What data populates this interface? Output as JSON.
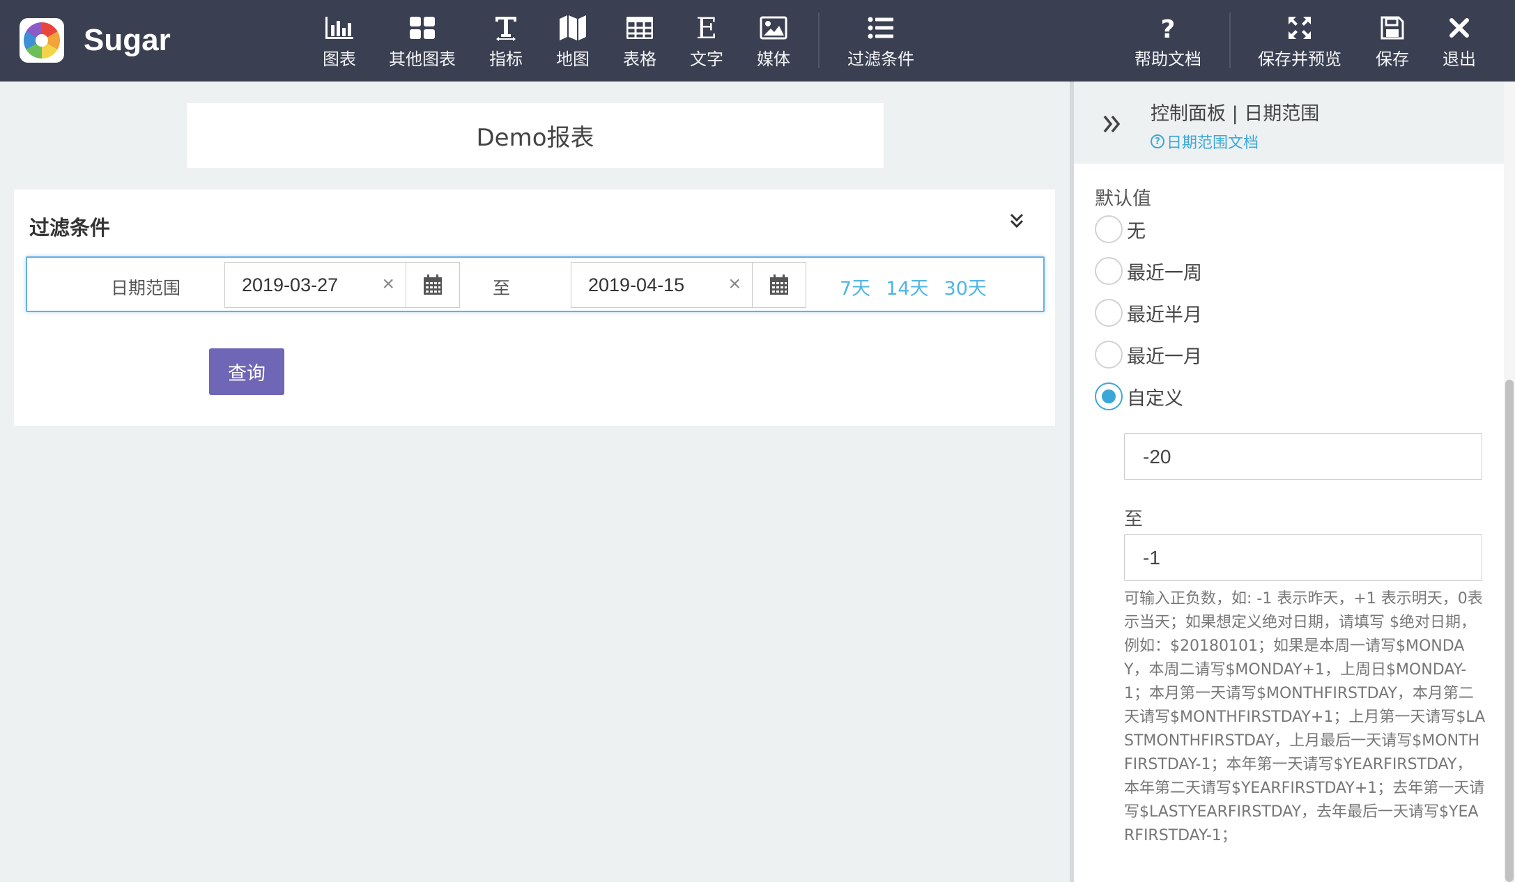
{
  "brand": {
    "name": "Sugar"
  },
  "nav": {
    "items": [
      {
        "label": "图表",
        "icon": "bar-chart-icon"
      },
      {
        "label": "其他图表",
        "icon": "grid-icon"
      },
      {
        "label": "指标",
        "icon": "text-height-icon"
      },
      {
        "label": "地图",
        "icon": "map-icon"
      },
      {
        "label": "表格",
        "icon": "table-icon"
      },
      {
        "label": "文字",
        "icon": "letter-e-icon"
      },
      {
        "label": "媒体",
        "icon": "image-icon"
      },
      {
        "label": "过滤条件",
        "icon": "list-icon"
      }
    ],
    "right": [
      {
        "label": "帮助文档",
        "icon": "question-icon"
      },
      {
        "label": "保存并预览",
        "icon": "expand-icon"
      },
      {
        "label": "保存",
        "icon": "save-icon"
      },
      {
        "label": "退出",
        "icon": "close-icon"
      }
    ]
  },
  "report": {
    "title": "Demo报表"
  },
  "filter": {
    "title": "过滤条件",
    "range_label": "日期范围",
    "start_date": "2019-03-27",
    "to_label": "至",
    "end_date": "2019-04-15",
    "clear_glyph": "×",
    "quick": [
      "7天",
      "14天",
      "30天"
    ],
    "query_button": "查询"
  },
  "panel": {
    "title": "控制面板 | 日期范围",
    "doc_link": "日期范围文档",
    "doc_icon": "?",
    "default_label": "默认值",
    "options": [
      "无",
      "最近一周",
      "最近半月",
      "最近一月",
      "自定义"
    ],
    "selected_option": "自定义",
    "from_value": "-20",
    "to_label": "至",
    "to_value": "-1",
    "help": "可输入正负数，如: -1 表示昨天，+1 表示明天，0表示当天；如果想定义绝对日期，请填写 $绝对日期，例如：$20180101；如果是本周一请写$MONDAY，本周二请写$MONDAY+1，上周日$MONDAY-1；本月第一天请写$MONTHFIRSTDAY，本月第二天请写$MONTHFIRSTDAY+1；上月第一天请写$LASTMONTHFIRSTDAY，上月最后一天请写$MONTHFIRSTDAY-1；本年第一天请写$YEARFIRSTDAY，本年第二天请写$YEARFIRSTDAY+1；去年第一天请写$LASTYEARFIRSTDAY，去年最后一天请写$YEARFIRSTDAY-1；"
  },
  "colors": {
    "topbar": "#3a3f51",
    "accent": "#3ba7d9",
    "query_button": "#6f66b6",
    "focus_border": "#66afe9"
  }
}
